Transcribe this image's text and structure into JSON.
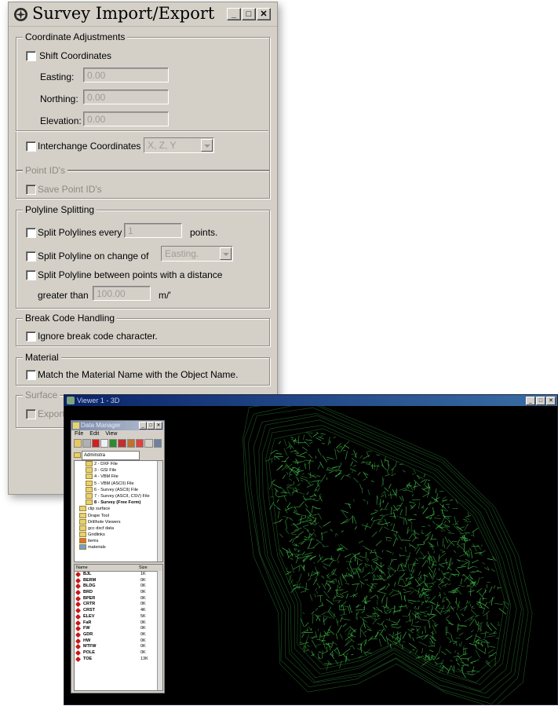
{
  "dialog": {
    "title": "Survey Import/Export",
    "coordinate_adjustments": {
      "legend": "Coordinate Adjustments",
      "shift_label": "Shift Coordinates",
      "easting_label": "Easting:",
      "easting_value": "0.00",
      "northing_label": "Northing:",
      "northing_value": "0.00",
      "elevation_label": "Elevation:",
      "elevation_value": "0.00",
      "interchange_label": "Interchange Coordinates",
      "interchange_value": "X, Z, Y"
    },
    "point_ids": {
      "legend": "Point ID's",
      "save_label": "Save Point ID's"
    },
    "polyline_splitting": {
      "legend": "Polyline Splitting",
      "split_every_label": "Split Polylines every",
      "split_every_value": "1",
      "points_suffix": "points.",
      "split_change_label": "Split Polyline on change of",
      "split_change_value": "Easting.",
      "split_distance_label": "Split Polyline between points with a distance",
      "greater_than_label": "greater than",
      "distance_value": "100.00",
      "distance_unit": "m/'"
    },
    "break_code": {
      "legend": "Break Code Handling",
      "ignore_label": "Ignore break code character."
    },
    "material": {
      "legend": "Material",
      "match_label": "Match the Material Name with the Object Name."
    },
    "surface": {
      "legend": "Surface",
      "export_label": "Export"
    }
  },
  "viewer": {
    "title": "Viewer 1 - 3D",
    "line_color": "#3fbf4a",
    "data_manager": {
      "title": "Data Manager",
      "menu": [
        "File",
        "Edit",
        "View"
      ],
      "combo_value": "Adminstra",
      "tree_items": [
        "2 - DXF File",
        "3 - GSI File",
        "4 - VBM File",
        "5 - VBM (ASCII) File",
        "6 - Survey (ASCII) File",
        "7 - Survey (ASCII, CSV) File",
        "8 - Survey (Free Form)",
        "clip surface",
        "Drape Tool",
        "Drillhole Viewers",
        "gcc dxcf data",
        "Gridlinks",
        "items",
        "materials"
      ],
      "list_headers": [
        "Name",
        "Size"
      ],
      "list_rows": [
        [
          "BJL",
          "1K"
        ],
        [
          "BERM",
          "0K"
        ],
        [
          "BLDG",
          "0K"
        ],
        [
          "BRD",
          "0K"
        ],
        [
          "BPER",
          "0K"
        ],
        [
          "CRTR",
          "0K"
        ],
        [
          "CRST",
          "4K"
        ],
        [
          "ELEV",
          "5K"
        ],
        [
          "FaR",
          "0K"
        ],
        [
          "FW",
          "0K"
        ],
        [
          "GDR",
          "0K"
        ],
        [
          "HW",
          "0K"
        ],
        [
          "MTFW",
          "0K"
        ],
        [
          "POLE",
          "0K"
        ],
        [
          "TOE",
          "13K"
        ]
      ]
    }
  }
}
